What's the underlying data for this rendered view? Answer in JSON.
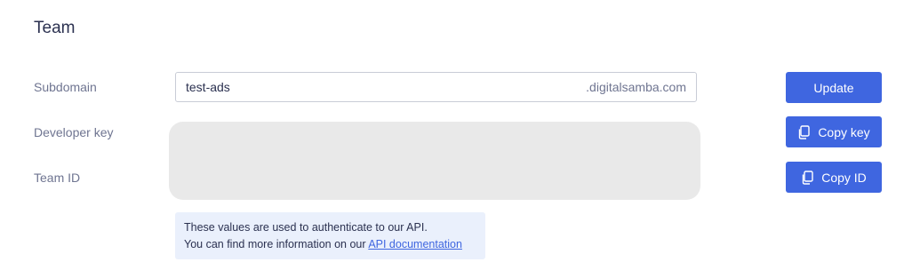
{
  "section": {
    "title": "Team"
  },
  "fields": {
    "subdomain_label": "Subdomain",
    "subdomain_value": "test-ads",
    "subdomain_suffix": ".digitalsamba.com",
    "developer_key_label": "Developer key",
    "team_id_label": "Team ID"
  },
  "buttons": {
    "update_label": "Update",
    "copy_key_label": "Copy key",
    "copy_id_label": "Copy ID",
    "copy_icon": "copy-icon"
  },
  "info": {
    "line1": "These values are used to authenticate to our API.",
    "line2_prefix": "You can find more information on our ",
    "link_text": "API documentation"
  },
  "colors": {
    "accent": "#3f66e0",
    "masked_bg": "#e9e9e9",
    "info_bg": "#eaf0fc"
  }
}
